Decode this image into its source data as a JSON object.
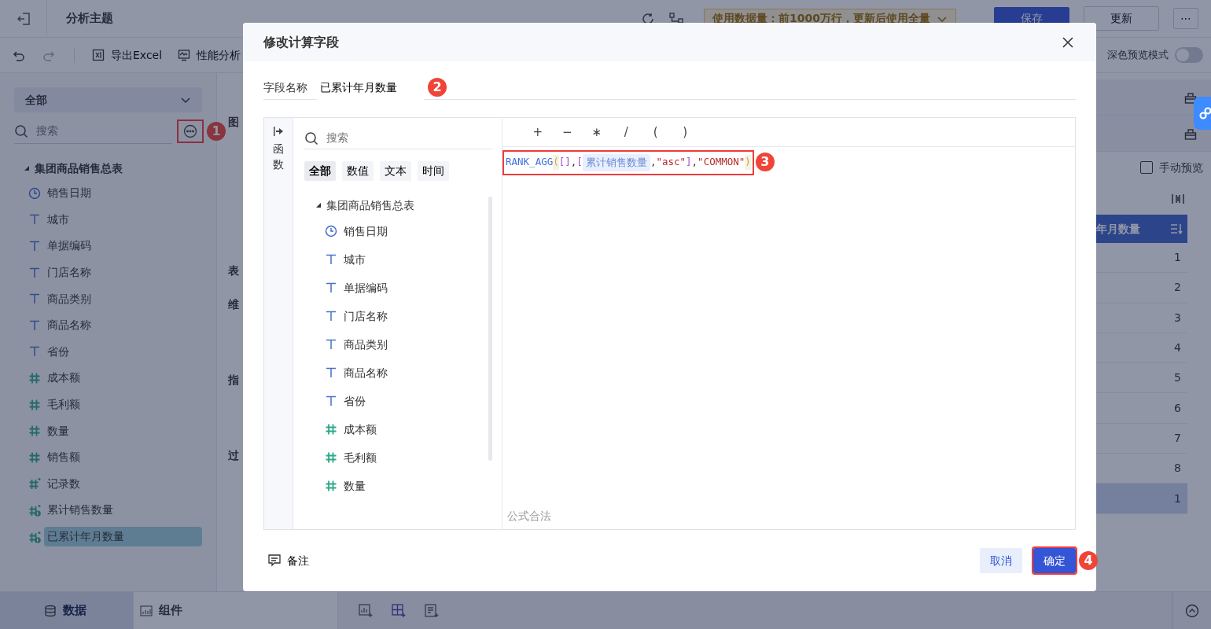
{
  "header": {
    "title": "分析主题",
    "data_notice": "使用数据量：前1000万行，更新后使用全量",
    "save": "保存",
    "update": "更新",
    "more": "⋯"
  },
  "toolbar": {
    "items": [
      "导出Excel",
      "性能分析"
    ],
    "dark_preview": {
      "label": "深色预览模式",
      "on": false
    }
  },
  "sidebar": {
    "scope": "全部",
    "search_placeholder": "搜索",
    "more_annotation": "1",
    "table": {
      "label": "集团商品销售总表",
      "expanded": true,
      "children": [
        {
          "label": "销售日期",
          "kind": "date",
          "selected": false
        },
        {
          "label": "城市",
          "kind": "text",
          "selected": false
        },
        {
          "label": "单据编码",
          "kind": "text",
          "selected": false
        },
        {
          "label": "门店名称",
          "kind": "text",
          "selected": false
        },
        {
          "label": "商品类别",
          "kind": "text",
          "selected": false
        },
        {
          "label": "商品名称",
          "kind": "text",
          "selected": false
        },
        {
          "label": "省份",
          "kind": "text",
          "selected": false
        },
        {
          "label": "成本额",
          "kind": "number",
          "selected": false
        },
        {
          "label": "毛利额",
          "kind": "number",
          "selected": false
        },
        {
          "label": "数量",
          "kind": "number",
          "selected": false
        },
        {
          "label": "销售额",
          "kind": "number",
          "selected": false
        },
        {
          "label": "记录数",
          "kind": "record",
          "selected": false
        },
        {
          "label": "累计销售数量",
          "kind": "calc",
          "selected": false
        },
        {
          "label": "已累计年月数量",
          "kind": "calc",
          "selected": true
        }
      ]
    }
  },
  "middle_panel": {
    "labels": [
      "图",
      "表",
      "维",
      "指",
      "过"
    ]
  },
  "right_panel": {
    "manual_preview": {
      "label": "手动预览",
      "checked": false
    },
    "column_header": "年月数量",
    "rows": [
      {
        "value": "1",
        "selected": false
      },
      {
        "value": "2",
        "selected": false
      },
      {
        "value": "3",
        "selected": false
      },
      {
        "value": "4",
        "selected": false
      },
      {
        "value": "5",
        "selected": false
      },
      {
        "value": "6",
        "selected": false
      },
      {
        "value": "7",
        "selected": false
      },
      {
        "value": "8",
        "selected": false
      },
      {
        "value": "1",
        "selected": true
      }
    ]
  },
  "bottom_bar": {
    "tabs": [
      {
        "label": "数据",
        "selected": true
      },
      {
        "label": "组件",
        "selected": false
      }
    ]
  },
  "dialog": {
    "title": "修改计算字段",
    "name_label": "字段名称",
    "name_value": "已累计年月数量",
    "name_annotation": "2",
    "side_tab": "函数",
    "search_placeholder": "搜索",
    "filters": [
      {
        "label": "全部",
        "selected": true
      },
      {
        "label": "数值",
        "selected": false
      },
      {
        "label": "文本",
        "selected": false
      },
      {
        "label": "时间",
        "selected": false
      }
    ],
    "table": {
      "label": "集团商品销售总表",
      "expanded": true,
      "children": [
        {
          "label": "销售日期",
          "kind": "date"
        },
        {
          "label": "城市",
          "kind": "text"
        },
        {
          "label": "单据编码",
          "kind": "text"
        },
        {
          "label": "门店名称",
          "kind": "text"
        },
        {
          "label": "商品类别",
          "kind": "text"
        },
        {
          "label": "商品名称",
          "kind": "text"
        },
        {
          "label": "省份",
          "kind": "text"
        },
        {
          "label": "成本额",
          "kind": "number"
        },
        {
          "label": "毛利额",
          "kind": "number"
        },
        {
          "label": "数量",
          "kind": "number"
        }
      ]
    },
    "operators": [
      "+",
      "−",
      "∗",
      "/",
      "(",
      ")"
    ],
    "formula": {
      "annotation": "3",
      "tokens": [
        {
          "text": "RANK_AGG",
          "kind": "function"
        },
        {
          "text": "(",
          "kind": "paren"
        },
        {
          "text": "[",
          "kind": "bracket"
        },
        {
          "text": "]",
          "kind": "bracket"
        },
        {
          "text": ",",
          "kind": "comma"
        },
        {
          "text": "[",
          "kind": "bracket"
        },
        {
          "text": "累计销售数量",
          "kind": "field"
        },
        {
          "text": ",",
          "kind": "comma"
        },
        {
          "text": "\"asc\"",
          "kind": "string"
        },
        {
          "text": "]",
          "kind": "bracket"
        },
        {
          "text": ",",
          "kind": "comma"
        },
        {
          "text": "\"COMMON\"",
          "kind": "string"
        },
        {
          "text": ")",
          "kind": "paren"
        }
      ]
    },
    "status": "公式合法",
    "note": "备注",
    "cancel": "取消",
    "confirm": "确定",
    "confirm_annotation": "4"
  }
}
